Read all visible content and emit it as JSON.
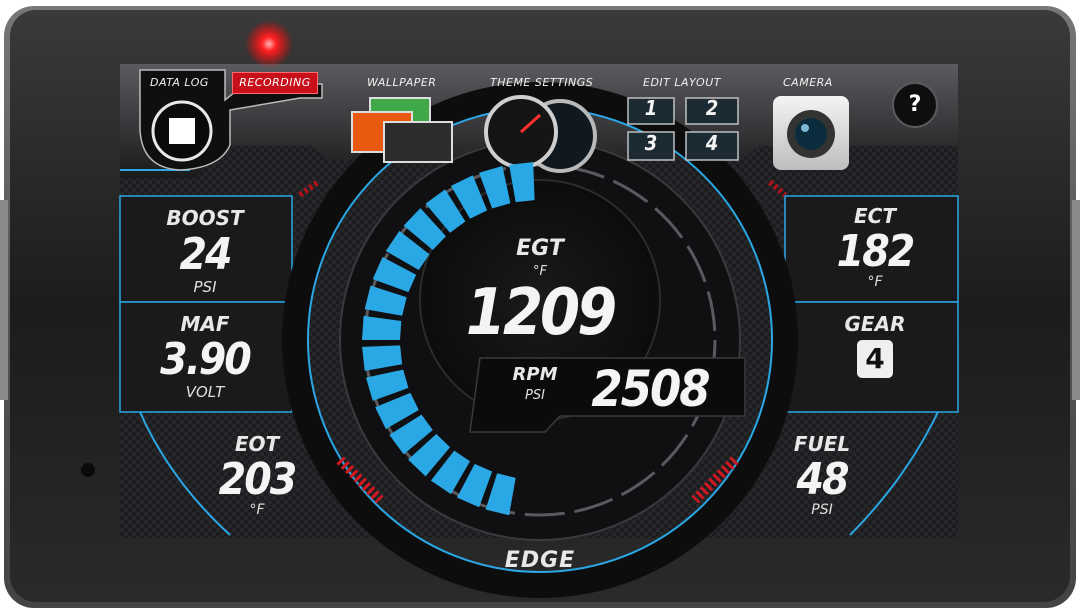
{
  "toolbar": {
    "data_log_label": "DATA LOG",
    "recording_badge": "RECORDING",
    "wallpaper_label": "WALLPAPER",
    "theme_label": "THEME SETTINGS",
    "edit_layout_label": "EDIT LAYOUT",
    "layout_slots": [
      "1",
      "2",
      "3",
      "4"
    ],
    "camera_label": "CAMERA",
    "help_glyph": "?"
  },
  "gauges": {
    "boost": {
      "label": "BOOST",
      "value": "24",
      "unit": "PSI"
    },
    "maf": {
      "label": "MAF",
      "value": "3.90",
      "unit": "VOLT"
    },
    "eot": {
      "label": "EOT",
      "value": "203",
      "unit": "°F"
    },
    "egt": {
      "label": "EGT",
      "unit": "°F",
      "value": "1209"
    },
    "rpm": {
      "label": "RPM",
      "unit": "PSI",
      "value": "2508"
    },
    "ect": {
      "label": "ECT",
      "value": "182",
      "unit": "°F"
    },
    "gear": {
      "label": "GEAR",
      "value": "4"
    },
    "fuel": {
      "label": "FUEL",
      "value": "48",
      "unit": "PSI"
    }
  },
  "egt_arc_level": 0.5,
  "brand": "EDGE",
  "colors": {
    "accent_blue": "#2aa8e6",
    "recording_red": "#e0101a",
    "bezel": "#2e2e2e"
  }
}
